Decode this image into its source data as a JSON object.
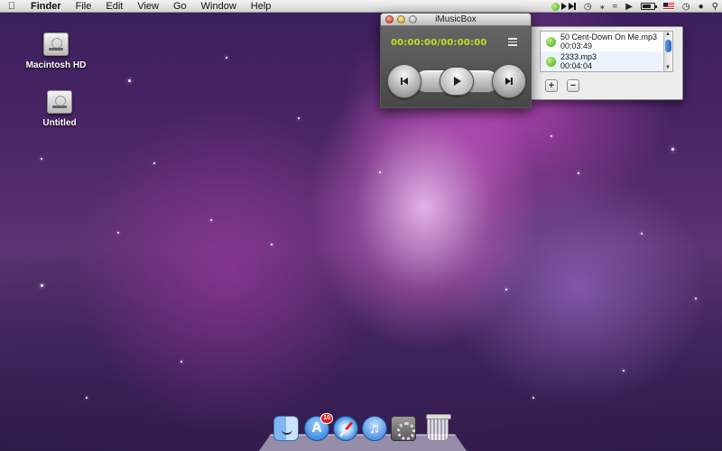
{
  "menubar": {
    "apple_icon": "apple-icon",
    "app_name": "Finder",
    "items": [
      "File",
      "Edit",
      "View",
      "Go",
      "Window",
      "Help"
    ],
    "status_icons": [
      "imusicbox-mini-icon",
      "time-machine-icon",
      "bluetooth-icon",
      "wifi-icon",
      "volume-icon",
      "battery-icon",
      "flag-icon",
      "clock-icon",
      "user-icon",
      "spotlight-icon"
    ]
  },
  "desktop": {
    "icons": [
      {
        "label": "Macintosh HD",
        "icon": "hard-drive-icon"
      },
      {
        "label": "Untitled",
        "icon": "hard-drive-icon"
      }
    ]
  },
  "player": {
    "title": "iMusicBox",
    "time_display": "00:00:00/00:00:00",
    "colors": {
      "time": "#b9e61c"
    }
  },
  "playlist": {
    "tracks": [
      {
        "name": "50 Cent-Down On Me.mp3",
        "duration": "00:03:49"
      },
      {
        "name": "2333.mp3",
        "duration": "00:04:04"
      }
    ],
    "add_label": "+",
    "remove_label": "−"
  },
  "dock": {
    "items": [
      "finder-icon",
      "app-store-icon",
      "safari-icon",
      "itunes-icon",
      "system-preferences-icon",
      "trash-icon"
    ],
    "app_store_badge": "10"
  }
}
